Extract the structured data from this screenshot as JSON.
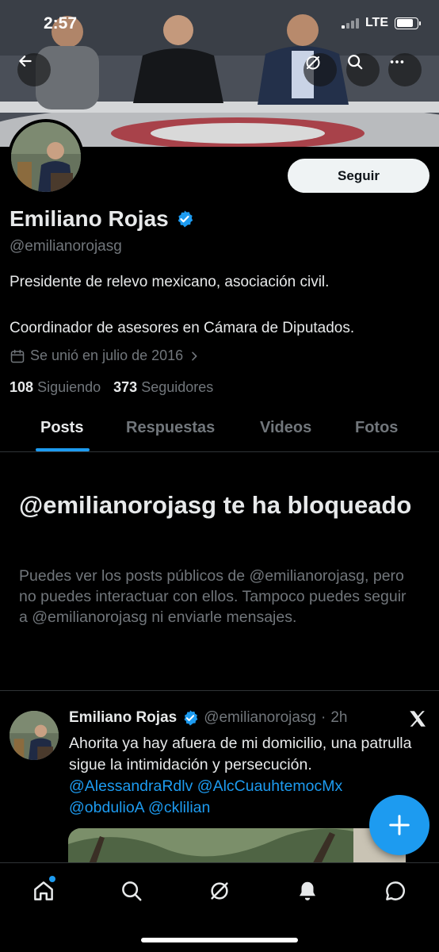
{
  "status_bar": {
    "time": "2:57",
    "network": "LTE",
    "battery_level": 0.82
  },
  "header": {
    "back_icon": "back-arrow-icon",
    "grok_icon": "grok-icon",
    "search_icon": "search-icon",
    "more_icon": "more-icon"
  },
  "profile": {
    "name": "Emiliano Rojas",
    "verified": true,
    "handle": "@emilianorojasg",
    "follow_label": "Seguir",
    "bio_line1": "Presidente de relevo mexicano, asociación civil.",
    "bio_line2": "Coordinador de asesores en Cámara de Diputados.",
    "joined": "Se unió en julio de 2016",
    "following_count": "108",
    "following_label": "Siguiendo",
    "followers_count": "373",
    "followers_label": "Seguidores"
  },
  "tabs": [
    {
      "label": "Posts",
      "active": true
    },
    {
      "label": "Respuestas",
      "active": false
    },
    {
      "label": "Videos",
      "active": false
    },
    {
      "label": "Fotos",
      "active": false
    }
  ],
  "blocked": {
    "title": "@emilianorojasg te ha bloqueado",
    "description": "Puedes ver los posts públicos de @emilianorojasg, pero no puedes interactuar con ellos. Tampoco puedes seguir a @emilianorojasg ni enviarle mensajes."
  },
  "post": {
    "name": "Emiliano Rojas",
    "handle": "@emilianorojasg",
    "separator": "·",
    "time": "2h",
    "text": "Ahorita ya hay afuera de mi domicilio, una patrulla sigue la  intimidación y persecución.",
    "mentions_line1": "@AlessandraRdlv @AlcCuauhtemocMx",
    "mentions_line2": "@obdulioA @cklilian"
  },
  "colors": {
    "accent": "#1d9bf0",
    "background": "#000000",
    "secondary_text": "#71767b"
  },
  "bottom_nav": [
    "home-icon",
    "search-icon",
    "grok-icon",
    "notifications-icon",
    "messages-icon"
  ]
}
